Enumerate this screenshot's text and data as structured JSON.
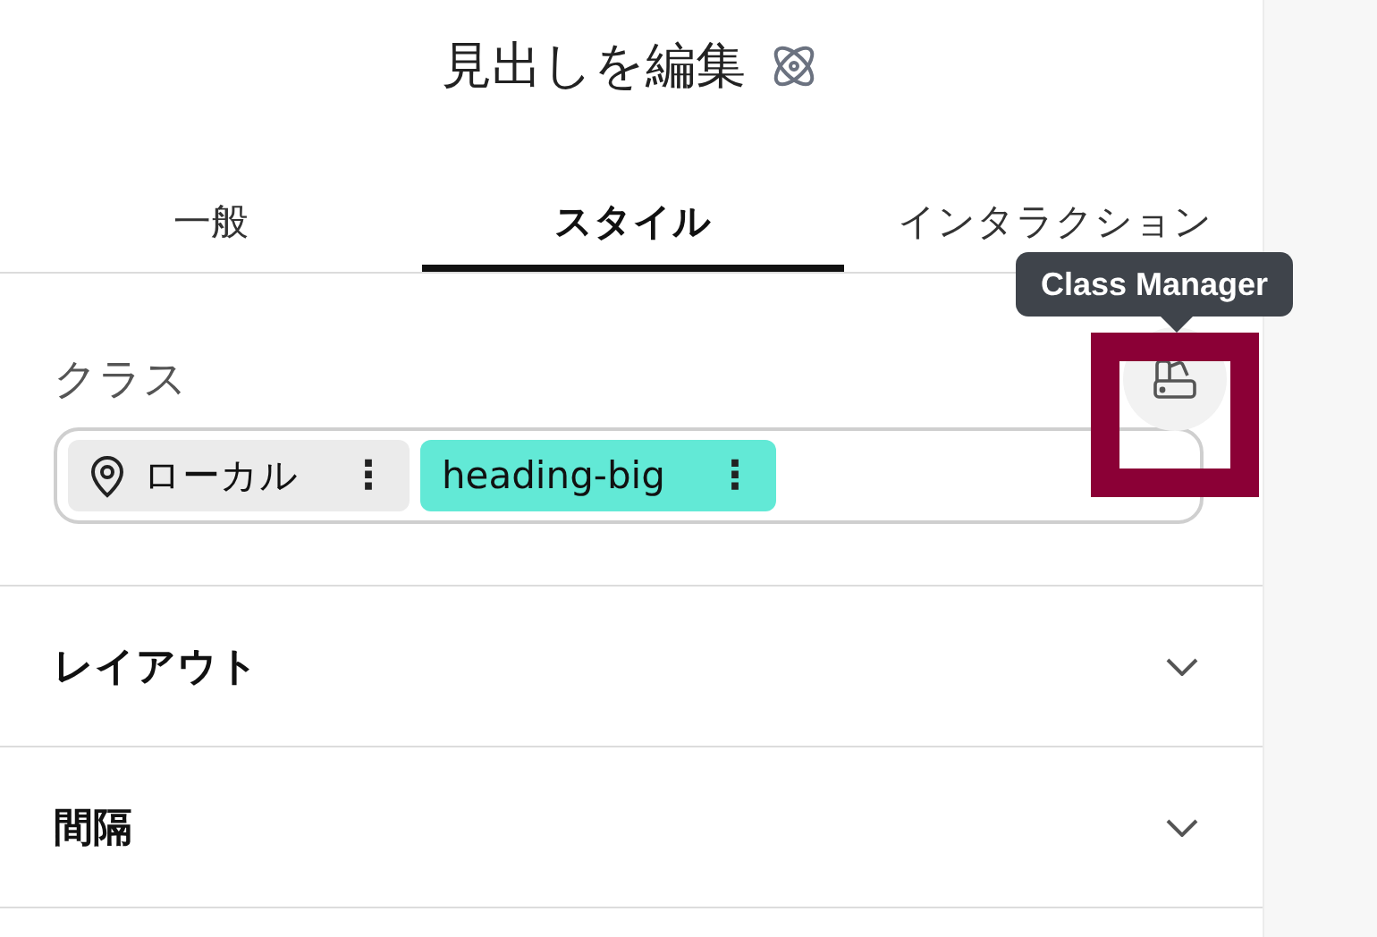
{
  "header": {
    "title": "見出しを編集"
  },
  "tabs": [
    {
      "label": "一般",
      "selected": false
    },
    {
      "label": "スタイル",
      "selected": true
    },
    {
      "label": "インタラクション",
      "selected": false
    }
  ],
  "classes": {
    "label": "クラス",
    "tooltip": "Class Manager",
    "chips": [
      {
        "kind": "local",
        "label": "ローカル",
        "menu": "⋮"
      },
      {
        "kind": "class",
        "label": "heading-big",
        "menu": "⋮"
      }
    ]
  },
  "sections": [
    {
      "title": "レイアウト",
      "expanded": false
    },
    {
      "title": "間隔",
      "expanded": false
    }
  ]
}
